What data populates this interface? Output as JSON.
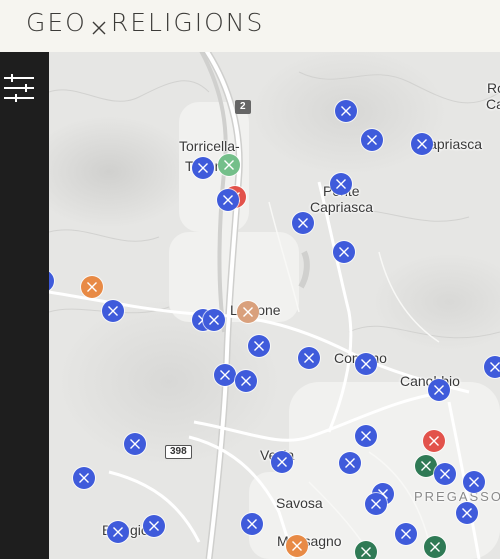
{
  "app": {
    "title": "GEO",
    "title_rest": "RELIGIONS"
  },
  "colors": {
    "blue": "#3f5bdb",
    "red": "#e2524b",
    "orange": "#e88a45",
    "peach": "#d9a07c",
    "light_green": "#74bf8a",
    "dark_green": "#2f7a55"
  },
  "icons": {
    "filter": "sliders-icon",
    "marker": "cross-icon"
  },
  "map": {
    "labels": [
      {
        "id": "torricella",
        "text": "Torricella-"
      },
      {
        "id": "taverne",
        "text": "Taverne"
      },
      {
        "id": "capriasca",
        "text": "Capriasca"
      },
      {
        "id": "ponte",
        "text": "Ponte"
      },
      {
        "id": "ponte2",
        "text": "Capriasca"
      },
      {
        "id": "lamone",
        "text": "Lamone"
      },
      {
        "id": "comano",
        "text": "Comano"
      },
      {
        "id": "canobbio",
        "text": "Canobbio"
      },
      {
        "id": "vezia",
        "text": "Vezia"
      },
      {
        "id": "savosa",
        "text": "Savosa"
      },
      {
        "id": "bioggio",
        "text": "Bioggio"
      },
      {
        "id": "massagno",
        "text": "Massagno"
      },
      {
        "id": "pregassona",
        "text": "PREGASSO"
      },
      {
        "id": "ro",
        "text": "Ro"
      },
      {
        "id": "ca",
        "text": "Ca"
      }
    ],
    "road_badges": [
      "2",
      "398"
    ],
    "markers": [
      {
        "c": "blue"
      },
      {
        "c": "blue"
      },
      {
        "c": "blue"
      },
      {
        "c": "blue"
      },
      {
        "c": "light_green"
      },
      {
        "c": "red"
      },
      {
        "c": "blue"
      },
      {
        "c": "blue"
      },
      {
        "c": "blue"
      },
      {
        "c": "blue"
      },
      {
        "c": "blue"
      },
      {
        "c": "orange"
      },
      {
        "c": "blue"
      },
      {
        "c": "blue"
      },
      {
        "c": "blue"
      },
      {
        "c": "peach"
      },
      {
        "c": "blue"
      },
      {
        "c": "blue"
      },
      {
        "c": "blue"
      },
      {
        "c": "blue"
      },
      {
        "c": "blue"
      },
      {
        "c": "blue"
      },
      {
        "c": "blue"
      },
      {
        "c": "blue"
      },
      {
        "c": "red"
      },
      {
        "c": "blue"
      },
      {
        "c": "dark_green"
      },
      {
        "c": "blue"
      },
      {
        "c": "blue"
      },
      {
        "c": "blue"
      },
      {
        "c": "blue"
      },
      {
        "c": "blue"
      },
      {
        "c": "blue"
      },
      {
        "c": "blue"
      },
      {
        "c": "blue"
      },
      {
        "c": "blue"
      },
      {
        "c": "blue"
      },
      {
        "c": "blue"
      },
      {
        "c": "dark_green"
      },
      {
        "c": "dark_green"
      },
      {
        "c": "blue"
      },
      {
        "c": "orange"
      }
    ]
  }
}
